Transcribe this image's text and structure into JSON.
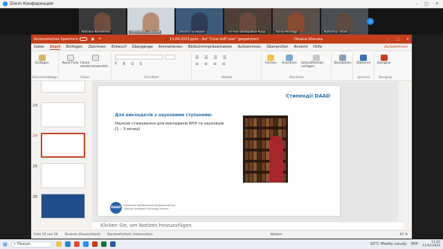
{
  "zoom": {
    "title": "Zoom Конференция",
    "participants": [
      {
        "name": "Nataliia Kovalenko"
      },
      {
        "name": "Oleksandr Labenko"
      },
      {
        "name": "Oksana Schwake"
      },
      {
        "name": "Тетяна Валеріївна Куць"
      },
      {
        "name": "Yuliia Pechoga"
      },
      {
        "name": "Nahornyi Vitalii"
      }
    ],
    "strip_arrow": "›"
  },
  "ppt": {
    "autosave_label": "Automatisches Speichern",
    "doc_title": "13.04.2023.pptx - Auf \"Core-Soft\"user\" gespeichert",
    "user_name": "Oksana Shevska",
    "tabs": [
      "Datei",
      "Start",
      "Einfügen",
      "Zeichnen",
      "Entwurf",
      "Übergänge",
      "Animationen",
      "Bildschirmpräsentation",
      "Aufzeichnen",
      "Überprüfen",
      "Ansicht",
      "Hilfe"
    ],
    "active_tab": "Start",
    "share_label": "Aufzeichnen",
    "ribbon": {
      "paste_label": "Einfügen",
      "new_slide_label": "Neue Folie",
      "reuse_label": "Folien wiederverwenden",
      "shapes_label": "Formen",
      "arrange_label": "Anordnen",
      "quick_styles_label": "Schnellformat-vorlagen",
      "edit_label": "Bearbeiten",
      "dictate_label": "Diktieren",
      "designer_label": "Designer",
      "groups": {
        "clipboard": "Zwischenablage",
        "slides": "Folien",
        "font": "Schriftart",
        "paragraph": "Absatz",
        "drawing": "Zeichnen",
        "voice": "Sprache",
        "designer": "Designer"
      }
    },
    "thumbnails": [
      {
        "num": "23"
      },
      {
        "num": "24",
        "selected": true
      },
      {
        "num": "25"
      },
      {
        "num": "26"
      }
    ],
    "slide": {
      "title": "Стипендії DAAD",
      "subtitle": "Для викладачів з науковими ступенями:",
      "body": "Наукові стажування для викладачів ВНЗ та науковців (1 – 3 місяці)",
      "logo": "DAAD",
      "org_text": "Deutscher Akademischer Austauschdienst German Academic Exchange Service"
    },
    "notes_placeholder": "Klicken Sie, um Notizen hinzuzufügen",
    "status": {
      "slide_count": "Folie 24 von 26",
      "language": "Deutsch (Deutschland)",
      "accessibility": "Barrierefreiheit: Untersuchen",
      "notes_btn": "Notizen",
      "zoom": "62 %"
    }
  },
  "taskbar": {
    "search_placeholder": "Пошук",
    "weather": "10°C  Mostly cloudy",
    "lang": "УКР",
    "time": "11:20",
    "date": "13.04.2023"
  }
}
